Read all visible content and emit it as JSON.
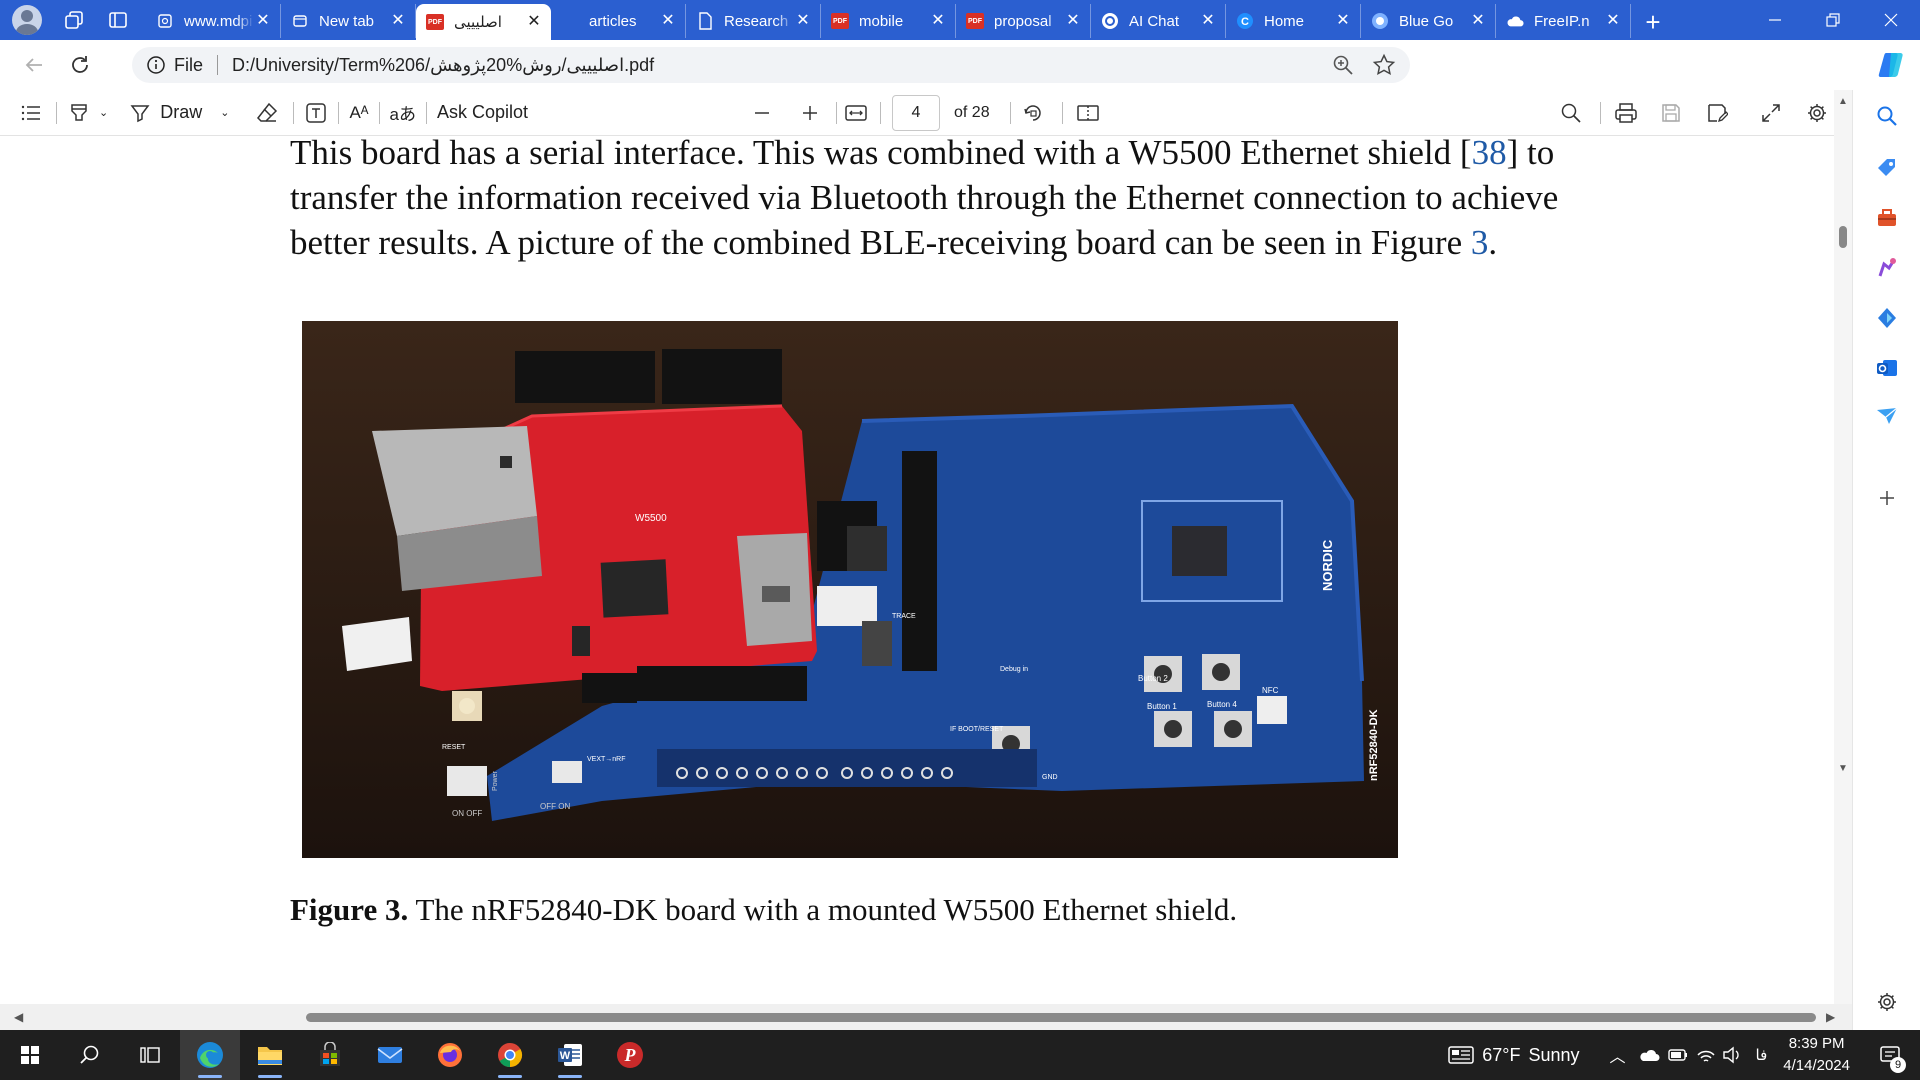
{
  "tabs": [
    {
      "label": "www.mdpi.com",
      "favicon": "web-icon",
      "active": false
    },
    {
      "label": "New tab",
      "favicon": "newtab-icon",
      "active": false
    },
    {
      "label": "اصلیییی",
      "favicon": "pdf-icon",
      "active": true
    },
    {
      "label": "articles",
      "favicon": "none",
      "active": false
    },
    {
      "label": "Research",
      "favicon": "document-icon",
      "active": false
    },
    {
      "label": "mobile",
      "favicon": "pdf-icon",
      "active": false
    },
    {
      "label": "proposal",
      "favicon": "pdf-icon",
      "active": false
    },
    {
      "label": "AI Chat",
      "favicon": "chat-icon",
      "active": false
    },
    {
      "label": "Home",
      "favicon": "c-icon",
      "active": false
    },
    {
      "label": "Blue Go",
      "favicon": "blue-icon",
      "active": false
    },
    {
      "label": "FreeIP.n",
      "favicon": "cloud-icon",
      "active": false
    }
  ],
  "address": {
    "scheme": "File",
    "url": "D:/University/Term%206/اصلیییی/روش%20پژوهش.pdf"
  },
  "pdf_toolbar": {
    "draw_label": "Draw",
    "read_aloud_label": "Aᴬ",
    "translate_label": "aあ",
    "copilot_label": "Ask Copilot",
    "current_page": "4",
    "page_total": "of 28"
  },
  "document": {
    "para_line1_a": "This board has a serial interface. This was combined with a W5500 Ethernet shield [",
    "para_ref": "38",
    "para_line1_b": "] to",
    "para_line2": "transfer the information received via Bluetooth through the Ethernet connection to achieve",
    "para_line3_a": "better results. A picture of the combined BLE-receiving board can be seen in Figure ",
    "para_fig_ref": "3",
    "para_line3_b": ".",
    "caption_label": "Figure 3.",
    "caption_text": " The nRF52840-DK board with a mounted W5500 Ethernet shield.",
    "figure_marks": {
      "red_board_chip": "W5500",
      "blue_board_brand": "NORDIC",
      "blue_board_model": "nRF52840-DK",
      "button1": "Button 1",
      "button2": "Button 2",
      "button4": "Button 4",
      "nfc": "NFC",
      "on_off": "ON OFF",
      "off_on": "OFF ON",
      "power": "Power",
      "reset": "RESET",
      "debug": "Debug in",
      "trace": "TRACE",
      "gnd": "GND",
      "if_boot": "IF BOOT/RESET",
      "vext": "VEXT→nRF"
    }
  },
  "taskbar": {
    "weather_temp": "67°F",
    "weather_desc": "Sunny",
    "lang": "فا",
    "time": "8:39 PM",
    "date": "4/14/2024",
    "notif_count": "9"
  },
  "colors": {
    "titlebar": "#2b5fd0",
    "taskbar": "#1f1f1f",
    "link": "#1f5aa6",
    "pcb_red": "#d8202a",
    "pcb_blue": "#1d4a9a"
  }
}
